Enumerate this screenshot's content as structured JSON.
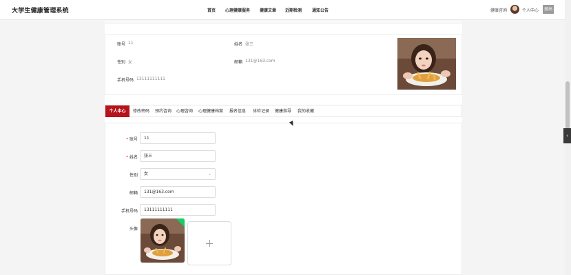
{
  "header": {
    "title": "大学生健康管理系统",
    "nav": [
      "首页",
      "心理健康服务",
      "健康文章",
      "近期检测",
      "通知公告"
    ],
    "consult_link": "健康咨询",
    "user_center": "个人中心",
    "logout": "退出"
  },
  "profile": {
    "account_label": "账号",
    "account_value": "11",
    "name_label": "姓名",
    "name_value": "张三",
    "gender_label": "性别",
    "gender_value": "女",
    "email_label": "邮箱",
    "email_value": "131@163.com",
    "phone_label": "手机号码",
    "phone_value": "13111111111"
  },
  "tabs": [
    "个人中心",
    "修改密码",
    "预约咨询",
    "心理咨询",
    "心理健康档案",
    "报名信息",
    "体检记录",
    "健康指导",
    "我的收藏"
  ],
  "form": {
    "account_label": "账号",
    "account_value": "11",
    "name_label": "姓名",
    "name_value": "张三",
    "gender_label": "性别",
    "gender_value": "女",
    "email_label": "邮箱",
    "email_value": "131@163.com",
    "phone_label": "手机号码",
    "phone_value": "13111111111",
    "avatar_label": "头像",
    "required_mark": "*"
  },
  "colors": {
    "accent": "#b5141b",
    "success": "#13ce66"
  },
  "icons": {
    "chevron": "chevron-down-icon",
    "plus": "plus-icon",
    "side": "chevron-left-icon"
  }
}
